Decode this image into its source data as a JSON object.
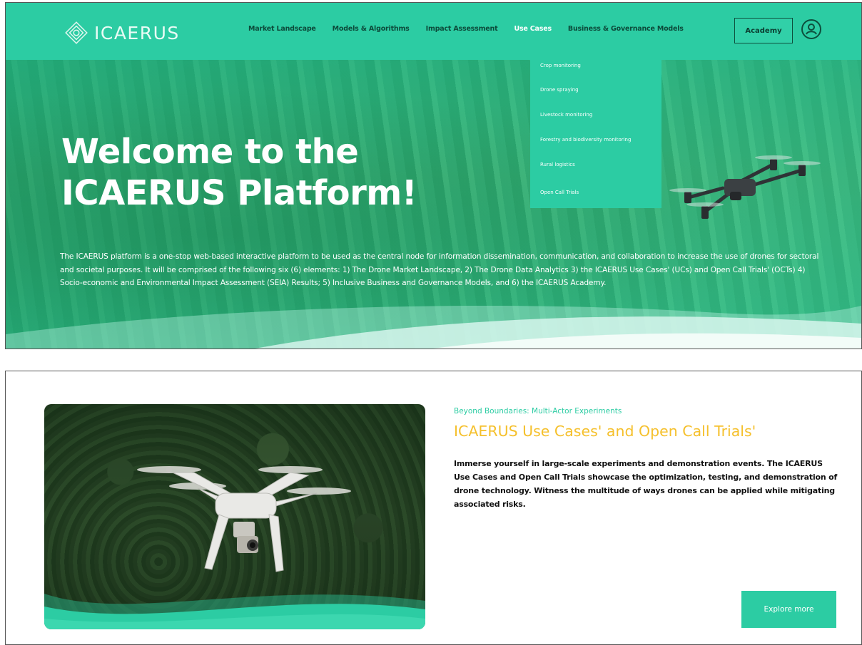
{
  "brand": {
    "logo_text": "ICAERUS",
    "colors": {
      "primary": "#2ccca3",
      "accent": "#f5c02c",
      "dark_text": "#0c4a3a",
      "white": "#ffffff"
    }
  },
  "navbar": {
    "items": [
      {
        "label": "Market Landscape"
      },
      {
        "label": "Models & Algorithms"
      },
      {
        "label": "Impact Assessment"
      },
      {
        "label": "Use Cases",
        "active": true
      },
      {
        "label": "Business & Governance Models"
      }
    ],
    "academy_label": "Academy",
    "user_icon": "user-circle-icon"
  },
  "dropdown": {
    "items": [
      {
        "label": "Crop monitoring"
      },
      {
        "label": "Drone spraying"
      },
      {
        "label": "Livestock monitoring"
      },
      {
        "label": "Forestry and biodiversity monitoring"
      },
      {
        "label": "Rural logistics"
      },
      {
        "label": "Open Call Trials"
      }
    ]
  },
  "hero": {
    "title_line1": "Welcome to the",
    "title_line2": "ICAERUS Platform!",
    "description": "The ICAERUS platform is a one-stop web-based interactive platform to be used as the central node for information dissemination, communication, and collaboration to increase the use of drones for sectoral and societal purposes. It will be comprised of the following six (6) elements: 1) The Drone Market Landscape, 2) The Drone Data Analytics 3) the ICAERUS Use Cases' (UCs) and Open Call Trials' (OCTs) 4) Socio-economic and Environmental Impact Assessment (SEIA) Results; 5) Inclusive Business and Governance Models, and 6) the ICAERUS Academy."
  },
  "card": {
    "kicker": "Beyond Boundaries: Multi-Actor Experiments",
    "title": "ICAERUS Use Cases' and Open Call Trials'",
    "body": "Immerse yourself in large-scale experiments and demonstration events. The ICAERUS Use Cases and Open Call Trials showcase the optimization, testing, and demonstration of drone technology. Witness the multitude of ways drones can be applied while mitigating associated risks.",
    "button_label": "Explore more"
  }
}
